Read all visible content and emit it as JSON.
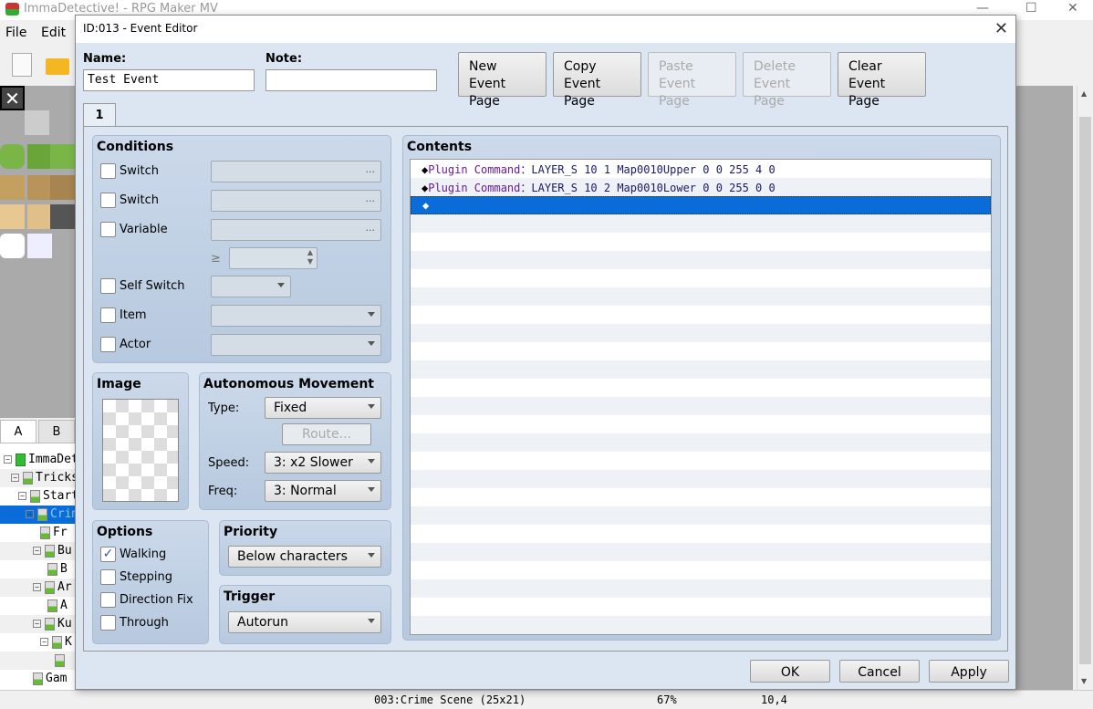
{
  "app": {
    "title": "ImmaDetective! - RPG Maker MV",
    "menu": [
      "File",
      "Edit"
    ],
    "tabs": [
      "A",
      "B"
    ],
    "tree": [
      {
        "label": "ImmaDetective!",
        "indent": 0,
        "expand": true,
        "root": true
      },
      {
        "label": "Tricks",
        "indent": 1,
        "expand": true
      },
      {
        "label": "Start",
        "indent": 2,
        "expand": true
      },
      {
        "label": "Crime Scene",
        "indent": 3,
        "expand": true,
        "selected": true
      },
      {
        "label": "Fr",
        "indent": 5,
        "expand": false
      },
      {
        "label": "Bu",
        "indent": 4,
        "expand": true
      },
      {
        "label": "B",
        "indent": 6,
        "expand": false
      },
      {
        "label": "Ar",
        "indent": 4,
        "expand": true
      },
      {
        "label": "A",
        "indent": 6,
        "expand": false
      },
      {
        "label": "Ku",
        "indent": 4,
        "expand": true
      },
      {
        "label": "K",
        "indent": 5,
        "expand": true
      },
      {
        "label": "",
        "indent": 7,
        "expand": false
      },
      {
        "label": "Gam",
        "indent": 4,
        "expand": false
      }
    ],
    "status": {
      "map": "003:Crime Scene (25x21)",
      "zoom": "67%",
      "coords": "10,4"
    }
  },
  "dialog": {
    "title": "ID:013 - Event Editor",
    "close": "✕",
    "name_label": "Name:",
    "name_value": "Test Event",
    "note_label": "Note:",
    "note_value": "",
    "page_buttons": [
      {
        "l1": "New",
        "l2": "Event Page",
        "enabled": true
      },
      {
        "l1": "Copy",
        "l2": "Event Page",
        "enabled": true
      },
      {
        "l1": "Paste",
        "l2": "Event Page",
        "enabled": false
      },
      {
        "l1": "Delete",
        "l2": "Event Page",
        "enabled": false
      },
      {
        "l1": "Clear",
        "l2": "Event Page",
        "enabled": true
      }
    ],
    "page_tab": "1",
    "conditions": {
      "title": "Conditions",
      "switch1": "Switch",
      "switch2": "Switch",
      "variable": "Variable",
      "gte": "≥",
      "self_switch": "Self Switch",
      "item": "Item",
      "actor": "Actor",
      "dots": "..."
    },
    "image": {
      "title": "Image"
    },
    "movement": {
      "title": "Autonomous Movement",
      "type_label": "Type:",
      "type_value": "Fixed",
      "route": "Route...",
      "speed_label": "Speed:",
      "speed_value": "3: x2 Slower",
      "freq_label": "Freq:",
      "freq_value": "3: Normal"
    },
    "options": {
      "title": "Options",
      "items": [
        {
          "label": "Walking",
          "checked": true
        },
        {
          "label": "Stepping",
          "checked": false
        },
        {
          "label": "Direction Fix",
          "checked": false
        },
        {
          "label": "Through",
          "checked": false
        }
      ]
    },
    "priority": {
      "title": "Priority",
      "value": "Below characters"
    },
    "trigger": {
      "title": "Trigger",
      "value": "Autorun"
    },
    "contents": {
      "title": "Contents",
      "rows": [
        {
          "cmd": "Plugin Command",
          "sep": "：",
          "args": "LAYER_S 10 1 Map0010Upper 0 0 255 4 0"
        },
        {
          "cmd": "Plugin Command",
          "sep": "：",
          "args": "LAYER_S 10 2 Map0010Lower 0 0 255 0 0"
        }
      ],
      "empty_marker": "◆"
    },
    "ok": "OK",
    "cancel": "Cancel",
    "apply": "Apply"
  }
}
